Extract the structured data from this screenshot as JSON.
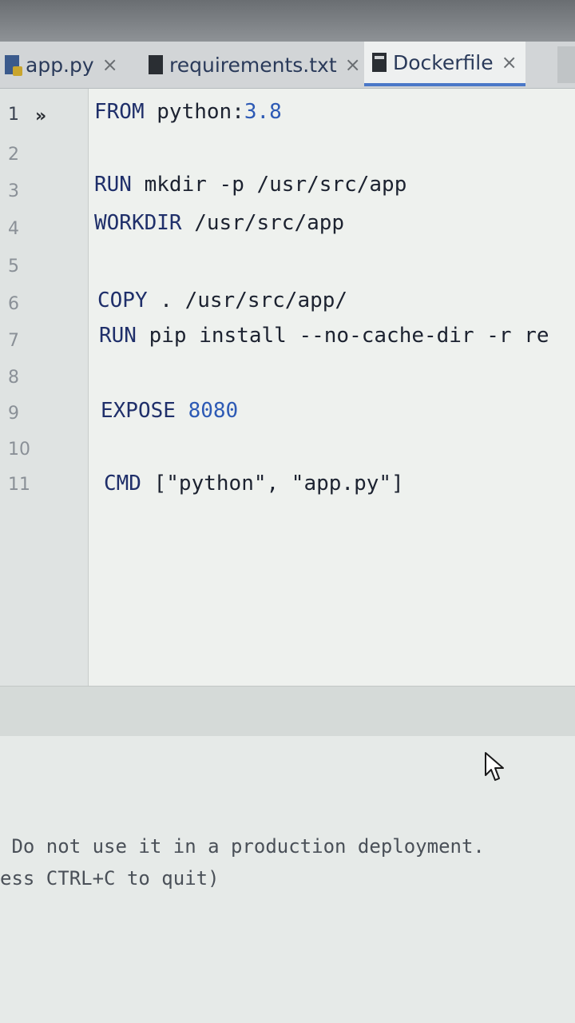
{
  "tabs": [
    {
      "label": "app.py",
      "icon": "python-file-icon",
      "active": false
    },
    {
      "label": "requirements.txt",
      "icon": "text-file-icon",
      "active": false
    },
    {
      "label": "Dockerfile",
      "icon": "docker-file-icon",
      "active": true
    }
  ],
  "editor": {
    "line_numbers": [
      "1",
      "2",
      "3",
      "4",
      "5",
      "6",
      "7",
      "8",
      "9",
      "10",
      "11"
    ],
    "lines": {
      "l1_kw": "FROM",
      "l1_rest": " python:",
      "l1_num": "3.8",
      "l3_kw": "RUN",
      "l3_rest": " mkdir -p /usr/src/app",
      "l4_kw": "WORKDIR",
      "l4_rest": " /usr/src/app",
      "l6_kw": "COPY",
      "l6_rest": " . /usr/src/app/",
      "l7_kw": "RUN",
      "l7_rest": " pip install --no-cache-dir -r re",
      "l9_kw": "EXPOSE",
      "l9_num": " 8080",
      "l11_kw": "CMD",
      "l11_rest": " [\"python\", \"app.py\"]"
    }
  },
  "terminal": {
    "line1": " Do not use it in a production deployment.",
    "line2": "ess CTRL+C to quit)"
  },
  "colors": {
    "keyword": "#1f2f6a",
    "number": "#2d5ab5",
    "active_tab_underline": "#4a78c8"
  }
}
